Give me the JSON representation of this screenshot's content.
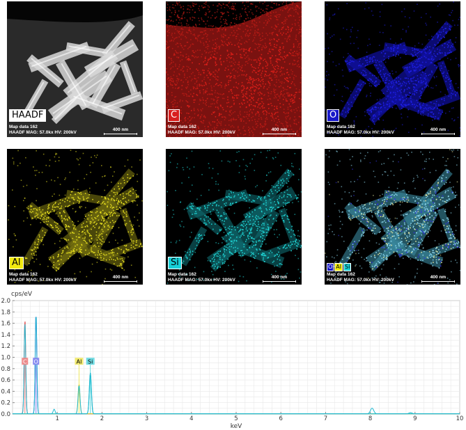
{
  "panels": [
    {
      "label": "HAADF",
      "meta1": "Map data 162",
      "meta2": "HAADF  MAG: 57.0kx  HV: 200kV",
      "scale": "400 nm",
      "color": "#ffffff",
      "tag_bg": "#ffffff",
      "tag_fg": "#000000"
    },
    {
      "label": "C",
      "meta1": "Map data 162",
      "meta2": "HAADF  MAG: 57.0kx  HV: 200kV",
      "scale": "400 nm",
      "color": "#e0201a",
      "tag_bg": "#d81e1e",
      "tag_fg": "#ffffff"
    },
    {
      "label": "O",
      "meta1": "Map data 162",
      "meta2": "HAADF  MAG: 57.0kx  HV: 200kV",
      "scale": "400 nm",
      "color": "#2020e8",
      "tag_bg": "#1818c8",
      "tag_fg": "#ffffff"
    },
    {
      "label": "Al",
      "meta1": "Map data 162",
      "meta2": "HAADF  MAG: 57.0kx  HV: 200kV",
      "scale": "400 nm",
      "color": "#e8e020",
      "tag_bg": "#f2ea10",
      "tag_fg": "#000000"
    },
    {
      "label": "Si",
      "meta1": "Map data 162",
      "meta2": "HAADF  MAG: 57.0kx  HV: 200kV",
      "scale": "400 nm",
      "color": "#20d8d8",
      "tag_bg": "#18d0d8",
      "tag_fg": "#000000"
    },
    {
      "label": "",
      "meta1": "Map data 162",
      "meta2": "HAADF  MAG: 57.0kx  HV: 200kV",
      "scale": "400 nm",
      "color": "#8fd8f0",
      "tag_bg": "",
      "tag_fg": "#000000"
    }
  ],
  "overlay_tags": [
    {
      "label": "O",
      "bg": "#1818c8",
      "fg": "#ffffff"
    },
    {
      "label": "Al",
      "bg": "#f2ea10",
      "fg": "#000000"
    },
    {
      "label": "Si",
      "bg": "#18d0d8",
      "fg": "#000000"
    }
  ],
  "chart_data": {
    "type": "line",
    "ylabel": "cps/eV",
    "xlabel": "keV",
    "xlim": [
      0,
      10
    ],
    "ylim": [
      0,
      2.0
    ],
    "xticks": [
      1,
      2,
      3,
      4,
      5,
      6,
      7,
      8,
      9,
      10
    ],
    "yticks": [
      "0.0",
      "0.2",
      "0.4",
      "0.6",
      "0.8",
      "1.0",
      "1.2",
      "1.4",
      "1.6",
      "1.8",
      "2.0"
    ],
    "grid": true,
    "series": [
      {
        "name": "C",
        "color": "#e03a3a",
        "peaks": [
          {
            "x": 0.277,
            "y": 1.65,
            "w": 0.025
          }
        ]
      },
      {
        "name": "O",
        "color": "#3a3ae0",
        "peaks": [
          {
            "x": 0.525,
            "y": 1.77,
            "w": 0.025
          }
        ]
      },
      {
        "name": "Al",
        "color": "#e8d820",
        "peaks": [
          {
            "x": 1.487,
            "y": 0.52,
            "w": 0.03
          }
        ]
      },
      {
        "name": "Si",
        "color": "#20c8d0",
        "peaks": [
          {
            "x": 1.74,
            "y": 0.72,
            "w": 0.032
          }
        ]
      },
      {
        "name": "",
        "color": "#20b8d0",
        "peaks": [
          {
            "x": 0.277,
            "y": 1.6,
            "w": 0.025
          },
          {
            "x": 0.525,
            "y": 1.77,
            "w": 0.025
          },
          {
            "x": 0.93,
            "y": 0.08,
            "w": 0.03
          },
          {
            "x": 1.487,
            "y": 0.5,
            "w": 0.03
          },
          {
            "x": 1.74,
            "y": 0.72,
            "w": 0.032
          },
          {
            "x": 8.04,
            "y": 0.1,
            "w": 0.05
          },
          {
            "x": 8.9,
            "y": 0.02,
            "w": 0.05
          }
        ]
      }
    ],
    "peak_labels": [
      {
        "label": "C",
        "x": 0.277,
        "y": 0.93,
        "bg": "#f08080",
        "fg": "#ffffff"
      },
      {
        "label": "O",
        "x": 0.525,
        "y": 0.93,
        "bg": "#8080f0",
        "fg": "#ffffff"
      },
      {
        "label": "Al",
        "x": 1.487,
        "y": 0.93,
        "bg": "#f0e860",
        "fg": "#000000"
      },
      {
        "label": "Si",
        "x": 1.74,
        "y": 0.93,
        "bg": "#60d8e0",
        "fg": "#000000"
      }
    ]
  }
}
